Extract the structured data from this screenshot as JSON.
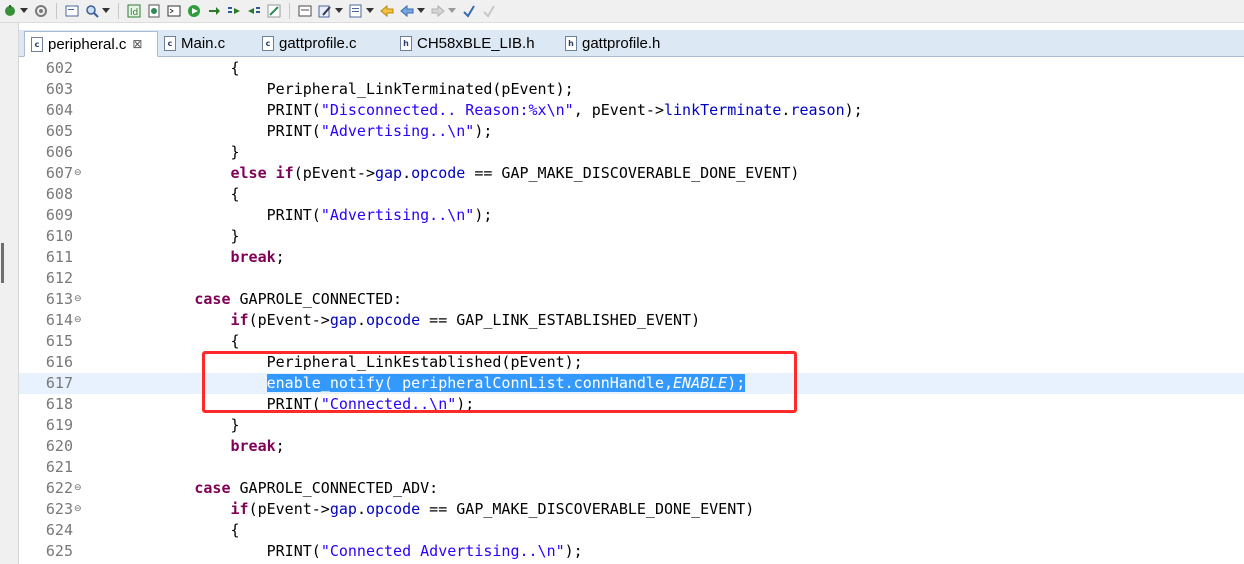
{
  "toolbar": {
    "icons": [
      "build-icon",
      "dropdown",
      "settings-icon",
      "separator",
      "console-icon",
      "search-icon",
      "dropdown",
      "separator",
      "download-icon",
      "debug-icon",
      "terminal-icon",
      "run-icon",
      "next-icon",
      "step-into-icon",
      "step-over-icon",
      "layout-icon",
      "separator",
      "view-icon",
      "dropdown",
      "edit-icon",
      "dropdown",
      "back-icon",
      "back-arrow-icon",
      "dropdown",
      "forward-arrow-icon",
      "dropdown",
      "pin-icon",
      "pin2-icon"
    ]
  },
  "tabs": [
    {
      "label": "peripheral.c",
      "icon": "c",
      "active": true,
      "close": "⊠"
    },
    {
      "label": "Main.c",
      "icon": "c",
      "active": false
    },
    {
      "label": "gattprofile.c",
      "icon": "c",
      "active": false
    },
    {
      "label": "CH58xBLE_LIB.h",
      "icon": "h",
      "active": false
    },
    {
      "label": "gattprofile.h",
      "icon": "h",
      "active": false
    }
  ],
  "code": {
    "lines": [
      {
        "num": "602",
        "fold": "",
        "indent": "        ",
        "segments": [
          {
            "t": "{",
            "c": ""
          }
        ]
      },
      {
        "num": "603",
        "fold": "",
        "indent": "          ",
        "segments": [
          {
            "t": "Peripheral_LinkTerminated(pEvent);",
            "c": ""
          }
        ]
      },
      {
        "num": "604",
        "fold": "",
        "indent": "          ",
        "segments": [
          {
            "t": "PRINT(",
            "c": ""
          },
          {
            "t": "\"Disconnected.. Reason:%x\\n\"",
            "c": "str"
          },
          {
            "t": ", pEvent->",
            "c": ""
          },
          {
            "t": "linkTerminate",
            "c": "fld"
          },
          {
            "t": ".",
            "c": ""
          },
          {
            "t": "reason",
            "c": "fld"
          },
          {
            "t": ");",
            "c": ""
          }
        ]
      },
      {
        "num": "605",
        "fold": "",
        "indent": "          ",
        "segments": [
          {
            "t": "PRINT(",
            "c": ""
          },
          {
            "t": "\"Advertising..\\n\"",
            "c": "str"
          },
          {
            "t": ");",
            "c": ""
          }
        ]
      },
      {
        "num": "606",
        "fold": "",
        "indent": "        ",
        "segments": [
          {
            "t": "}",
            "c": ""
          }
        ]
      },
      {
        "num": "607",
        "fold": "⊖",
        "indent": "        ",
        "segments": [
          {
            "t": "else if",
            "c": "kw"
          },
          {
            "t": "(pEvent->",
            "c": ""
          },
          {
            "t": "gap",
            "c": "fld"
          },
          {
            "t": ".",
            "c": ""
          },
          {
            "t": "opcode",
            "c": "fld"
          },
          {
            "t": " == GAP_MAKE_DISCOVERABLE_DONE_EVENT)",
            "c": ""
          }
        ]
      },
      {
        "num": "608",
        "fold": "",
        "indent": "        ",
        "segments": [
          {
            "t": "{",
            "c": ""
          }
        ]
      },
      {
        "num": "609",
        "fold": "",
        "indent": "          ",
        "segments": [
          {
            "t": "PRINT(",
            "c": ""
          },
          {
            "t": "\"Advertising..\\n\"",
            "c": "str"
          },
          {
            "t": ");",
            "c": ""
          }
        ]
      },
      {
        "num": "610",
        "fold": "",
        "indent": "        ",
        "segments": [
          {
            "t": "}",
            "c": ""
          }
        ]
      },
      {
        "num": "611",
        "fold": "",
        "indent": "        ",
        "segments": [
          {
            "t": "break",
            "c": "kw"
          },
          {
            "t": ";",
            "c": ""
          }
        ]
      },
      {
        "num": "612",
        "fold": "",
        "indent": "",
        "segments": []
      },
      {
        "num": "613",
        "fold": "⊖",
        "indent": "      ",
        "segments": [
          {
            "t": "case",
            "c": "kw"
          },
          {
            "t": " GAPROLE_CONNECTED:",
            "c": ""
          }
        ]
      },
      {
        "num": "614",
        "fold": "⊖",
        "indent": "        ",
        "segments": [
          {
            "t": "if",
            "c": "kw"
          },
          {
            "t": "(pEvent->",
            "c": ""
          },
          {
            "t": "gap",
            "c": "fld"
          },
          {
            "t": ".",
            "c": ""
          },
          {
            "t": "opcode",
            "c": "fld"
          },
          {
            "t": " == GAP_LINK_ESTABLISHED_EVENT)",
            "c": ""
          }
        ]
      },
      {
        "num": "615",
        "fold": "",
        "indent": "        ",
        "segments": [
          {
            "t": "{",
            "c": ""
          }
        ]
      },
      {
        "num": "616",
        "fold": "",
        "indent": "          ",
        "segments": [
          {
            "t": "Peripheral_LinkEstablished(pEvent);",
            "c": ""
          }
        ]
      },
      {
        "num": "617",
        "fold": "",
        "indent": "          ",
        "current": true,
        "segments": [
          {
            "t": "enable_notify( peripheralConnList.connHandle,",
            "c": "sel"
          },
          {
            "t": "ENABLE",
            "c": "sel-ital"
          },
          {
            "t": ");",
            "c": "sel"
          }
        ]
      },
      {
        "num": "618",
        "fold": "",
        "indent": "          ",
        "segments": [
          {
            "t": "PRINT(",
            "c": ""
          },
          {
            "t": "\"Connected..\\n\"",
            "c": "str"
          },
          {
            "t": ");",
            "c": ""
          }
        ]
      },
      {
        "num": "619",
        "fold": "",
        "indent": "        ",
        "segments": [
          {
            "t": "}",
            "c": ""
          }
        ]
      },
      {
        "num": "620",
        "fold": "",
        "indent": "        ",
        "segments": [
          {
            "t": "break",
            "c": "kw"
          },
          {
            "t": ";",
            "c": ""
          }
        ]
      },
      {
        "num": "621",
        "fold": "",
        "indent": "",
        "segments": []
      },
      {
        "num": "622",
        "fold": "⊖",
        "indent": "      ",
        "segments": [
          {
            "t": "case",
            "c": "kw"
          },
          {
            "t": " GAPROLE_CONNECTED_ADV:",
            "c": ""
          }
        ]
      },
      {
        "num": "623",
        "fold": "⊖",
        "indent": "        ",
        "segments": [
          {
            "t": "if",
            "c": "kw"
          },
          {
            "t": "(pEvent->",
            "c": ""
          },
          {
            "t": "gap",
            "c": "fld"
          },
          {
            "t": ".",
            "c": ""
          },
          {
            "t": "opcode",
            "c": "fld"
          },
          {
            "t": " == GAP_MAKE_DISCOVERABLE_DONE_EVENT)",
            "c": ""
          }
        ]
      },
      {
        "num": "624",
        "fold": "",
        "indent": "        ",
        "segments": [
          {
            "t": "{",
            "c": ""
          }
        ]
      },
      {
        "num": "625",
        "fold": "",
        "indent": "          ",
        "segments": [
          {
            "t": "PRINT(",
            "c": ""
          },
          {
            "t": "\"Connected Advertising..\\n\"",
            "c": "str"
          },
          {
            "t": ");",
            "c": ""
          }
        ]
      }
    ]
  },
  "colors": {
    "keyword": "#7f0055",
    "string": "#2a00ff",
    "field": "#0000c0",
    "selection": "#3399ff",
    "annotation_box": "#ff2b2b"
  }
}
